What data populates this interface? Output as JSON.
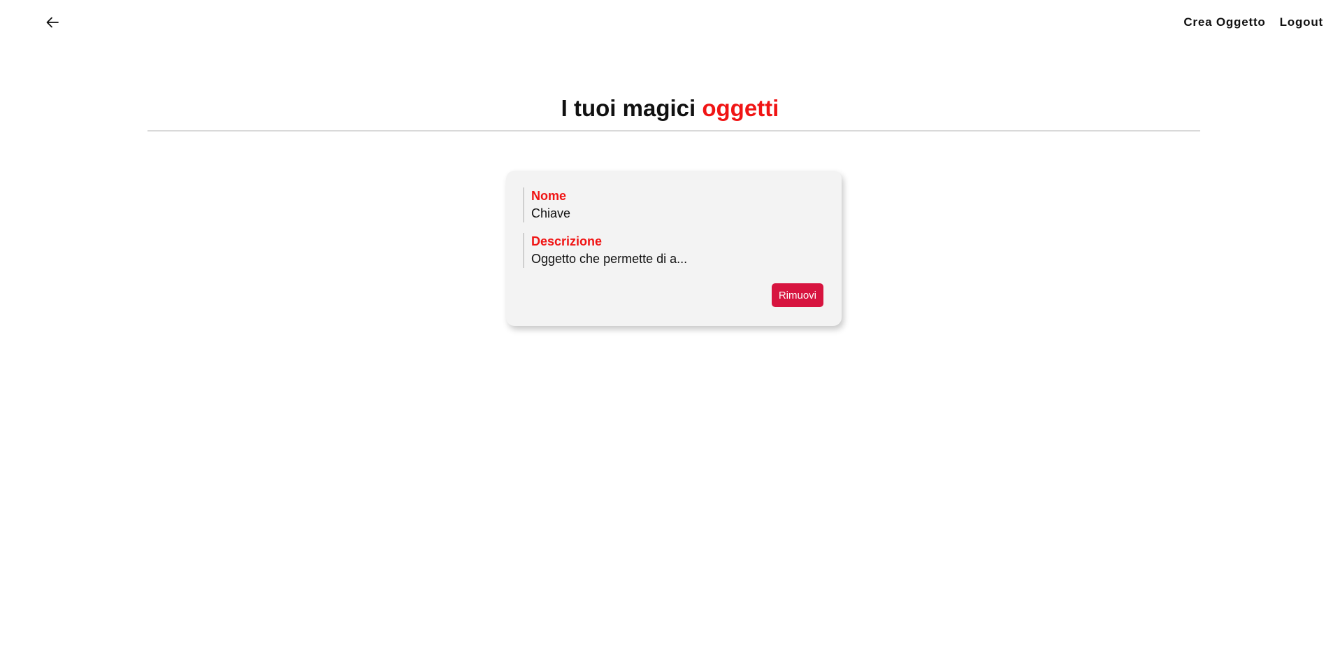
{
  "nav": {
    "back_icon": "arrow-left-icon",
    "create_label": "Crea Oggetto",
    "logout_label": "Logout"
  },
  "page": {
    "title_main": "I tuoi magici",
    "title_accent": "oggetti"
  },
  "items": [
    {
      "name_label": "Nome",
      "name_value": "Chiave",
      "description_label": "Descrizione",
      "description_value": "Oggetto che permette di a...",
      "remove_label": "Rimuovi"
    }
  ],
  "colors": {
    "accent": "#f01414",
    "remove_button": "#d7143f",
    "card_background": "#f3f3f3"
  }
}
